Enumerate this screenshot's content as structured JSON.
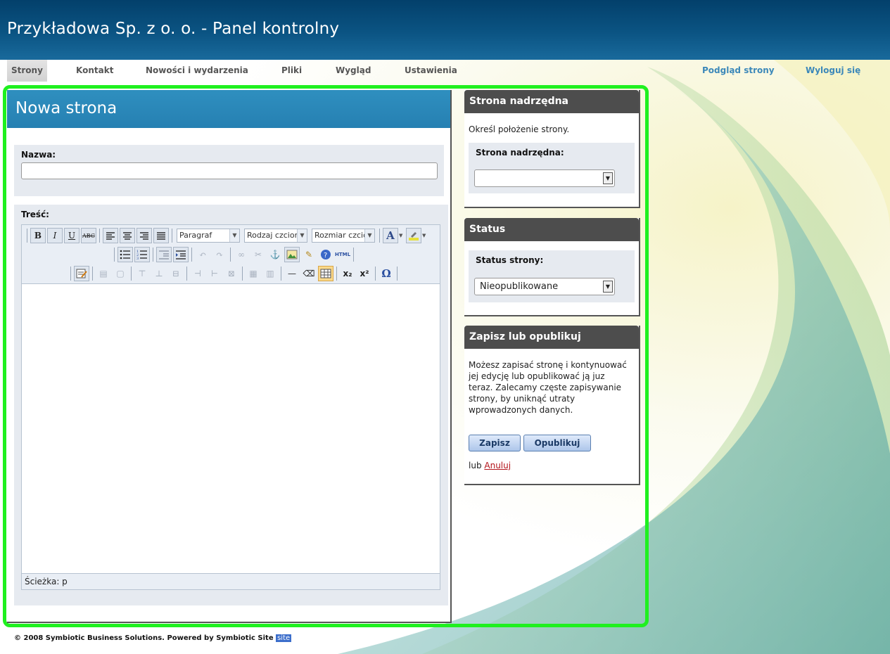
{
  "header": {
    "title": "Przykładowa Sp. z o. o. - Panel kontrolny"
  },
  "nav": {
    "items": [
      {
        "label": "Strony"
      },
      {
        "label": "Kontakt"
      },
      {
        "label": "Nowości i wydarzenia"
      },
      {
        "label": "Pliki"
      },
      {
        "label": "Wygląd"
      },
      {
        "label": "Ustawienia"
      }
    ],
    "active": "Strony",
    "right": [
      {
        "label": "Podgląd strony"
      },
      {
        "label": "Wyloguj się"
      }
    ]
  },
  "main": {
    "title": "Nowa strona",
    "name_label": "Nazwa:",
    "name_value": "",
    "content_label": "Treść:",
    "editor": {
      "format_select": "Paragraf",
      "font_select": "Rodzaj czcionk",
      "size_select": "Rozmiar czcion",
      "bold": "B",
      "italic": "I",
      "underline": "U",
      "strike": "ABC",
      "path_label": "Ścieżka: p"
    }
  },
  "side": {
    "parent": {
      "title": "Strona nadrzędna",
      "desc": "Określ położenie strony.",
      "field_label": "Strona nadrzędna:",
      "value": ""
    },
    "status": {
      "title": "Status",
      "field_label": "Status strony:",
      "value": "Nieopublikowane"
    },
    "publish": {
      "title": "Zapisz lub opublikuj",
      "desc": "Możesz zapisać stronę i kontynuować jej edycję lub opublikować ją juz teraz. Zalecamy częste zapisywanie strony, by uniknąć utraty wprowadzonych danych.",
      "save_label": "Zapisz",
      "publish_label": "Opublikuj",
      "or_label": "lub",
      "cancel_label": "Anuluj"
    }
  },
  "footer": {
    "text": "© 2008 Symbiotic Business Solutions. Powered by Symbiotic Site",
    "badge": "site"
  },
  "colors": {
    "header": "#0b5483",
    "title_bar": "#2a88b9",
    "side_head": "#4d4d4d",
    "highlight": "#1ff01f",
    "link_right": "#3c88b9",
    "cancel_link": "#b3141b"
  }
}
